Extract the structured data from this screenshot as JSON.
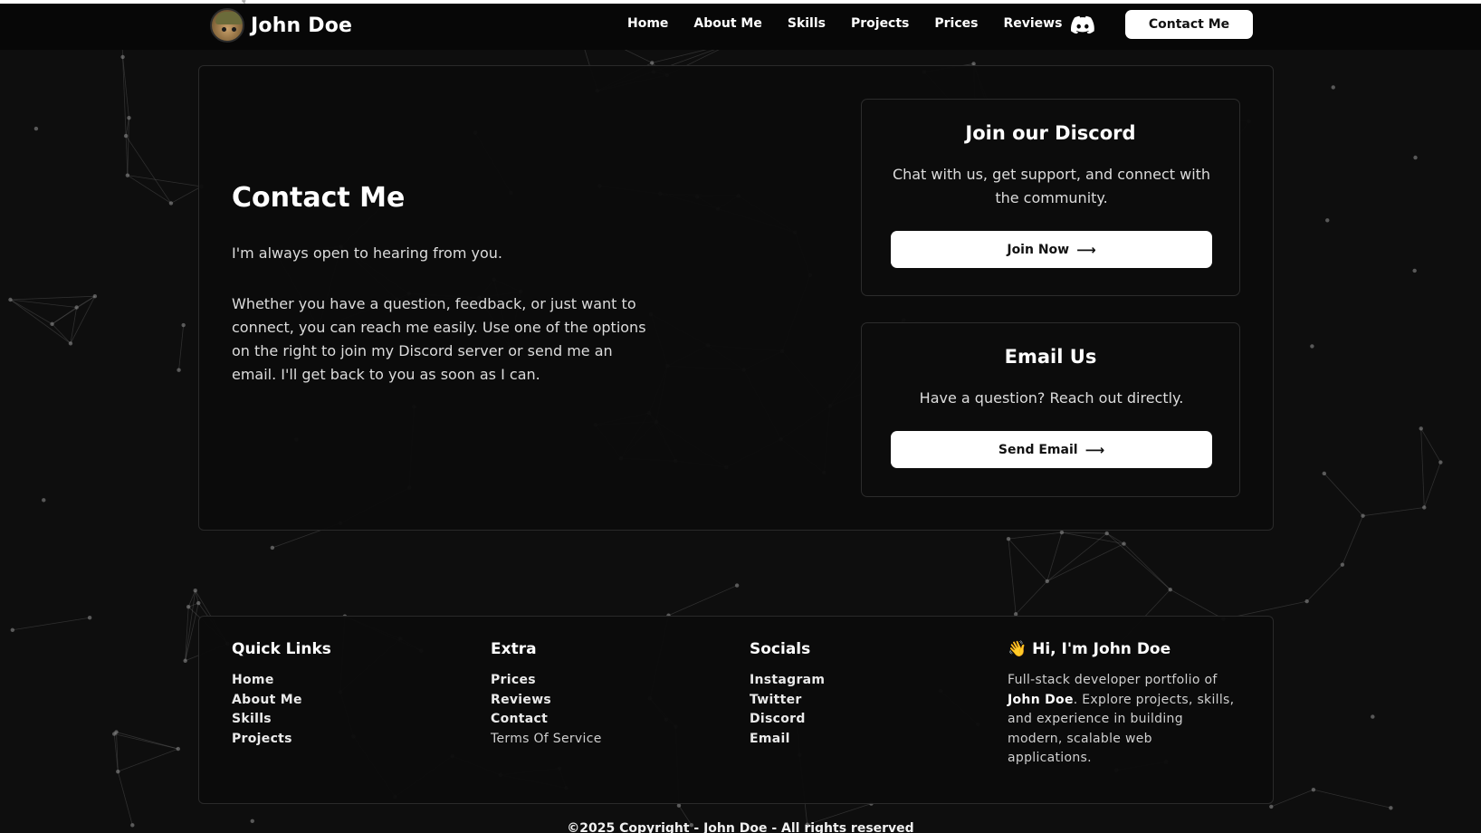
{
  "brand": {
    "name": "John Doe"
  },
  "nav": {
    "links": [
      "Home",
      "About Me",
      "Skills",
      "Projects",
      "Prices",
      "Reviews"
    ],
    "contact_label": "Contact Me"
  },
  "contact": {
    "title": "Contact Me",
    "intro": "I'm always open to hearing from you.",
    "body": "Whether you have a question, feedback, or just want to connect, you can reach me easily. Use one of the options on the right to join my Discord server or send me an email. I'll get back to you as soon as I can.",
    "discord": {
      "title": "Join our Discord",
      "description": "Chat with us, get support, and connect with the community.",
      "button": "Join Now"
    },
    "email": {
      "title": "Email Us",
      "description": "Have a question? Reach out directly.",
      "button": "Send Email"
    }
  },
  "footer": {
    "quick_links": {
      "heading": "Quick Links",
      "items": [
        "Home",
        "About Me",
        "Skills",
        "Projects"
      ]
    },
    "extra": {
      "heading": "Extra",
      "items": [
        "Prices",
        "Reviews",
        "Contact",
        "Terms Of Service"
      ]
    },
    "socials": {
      "heading": "Socials",
      "items": [
        "Instagram",
        "Twitter",
        "Discord",
        "Email"
      ]
    },
    "about": {
      "heading": "Hi, I'm John Doe",
      "wave": "👋",
      "text_before": "Full-stack developer portfolio of ",
      "name": "John Doe",
      "text_after": ". Explore projects, skills, and experience in building modern, scalable web applications."
    },
    "copyright": "©2025 Copyright - John Doe - All rights reserved"
  },
  "colors": {
    "background": "#0e0e0e",
    "card": "#0b0b0b",
    "border": "#2a2a2a",
    "button": "#ffffff",
    "text": "#ffffff",
    "constellation": "#6e6e6e"
  },
  "icons": {
    "brand": "cat-avatar",
    "nav": "discord-icon",
    "button_arrow": "arrow-right-icon"
  }
}
